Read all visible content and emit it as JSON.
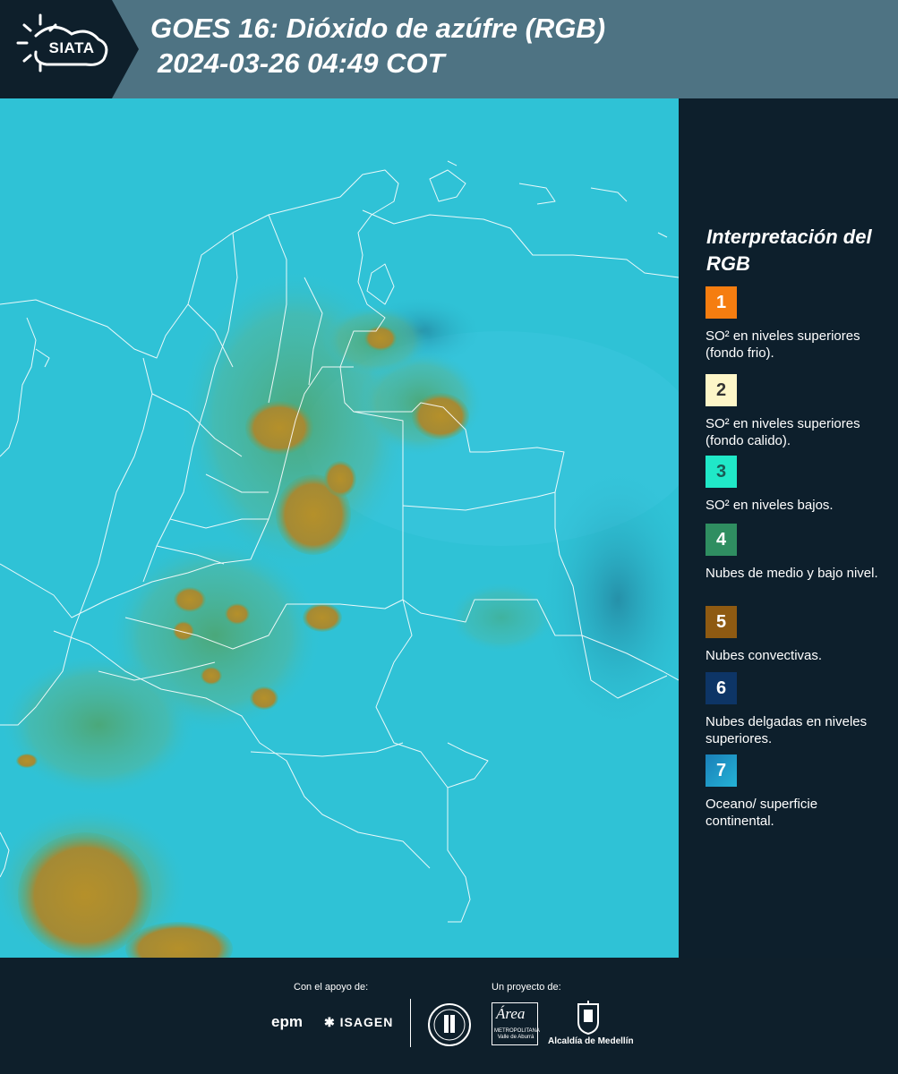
{
  "header": {
    "logo_text": "SIATA",
    "title_line1": "GOES 16: Dióxido de azúfre (RGB)",
    "title_line2": "2024-03-26 04:49 COT"
  },
  "map": {
    "icon": "satellite-rgb-map-colombia",
    "ocean_color": "#2fc2d6",
    "convective_color": "#b0912c",
    "border_color": "#ffffff"
  },
  "legend": {
    "title": "Interpretación del RGB",
    "items": [
      {
        "number": "1",
        "label": "SO² en niveles superiores (fondo frio).",
        "color": "#f57d10",
        "text_color": "#ffffff"
      },
      {
        "number": "2",
        "label": "SO² en niveles superiores (fondo calido).",
        "color": "#fdf6c8",
        "text_color": "#333333"
      },
      {
        "number": "3",
        "label": "SO² en niveles bajos.",
        "color": "#20e8c8",
        "text_color": "#1a5a55"
      },
      {
        "number": "4",
        "label": "Nubes de medio y bajo nivel.",
        "color": "#2f8e61",
        "text_color": "#ffffff"
      },
      {
        "number": "5",
        "label": "Nubes convectivas.",
        "color": "#8e5a12",
        "text_color": "#ffffff"
      },
      {
        "number": "6",
        "label": "Nubes delgadas en niveles superiores.",
        "color": "#0d3566",
        "text_color": "#ffffff"
      },
      {
        "number": "7",
        "label": "Oceano/ superficie continental.",
        "color": "#1e95c4",
        "text_color": "#ffffff"
      }
    ]
  },
  "footer": {
    "support_caption": "Con el apoyo de:",
    "project_caption": "Un proyecto de:",
    "epm": "epm",
    "isagen": "ISAGEN",
    "area_logo": "Área",
    "area_sub": "METROPOLITANA Valle de Aburrá",
    "alcaldia": "Alcaldía de Medellín"
  }
}
